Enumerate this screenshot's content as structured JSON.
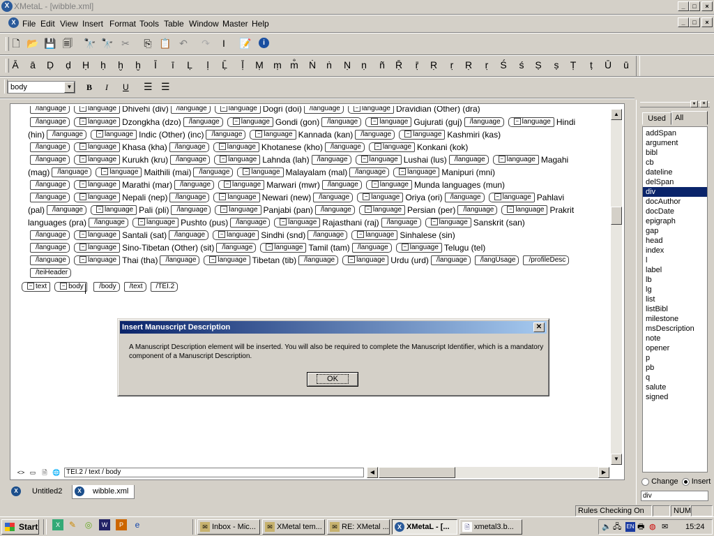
{
  "window": {
    "title": "XMetaL - [wibble.xml]",
    "controls": [
      "_",
      "□",
      "×"
    ]
  },
  "menu": [
    "File",
    "Edit",
    "View",
    "Insert",
    "Format",
    "Tools",
    "Table",
    "Window",
    "Master",
    "Help"
  ],
  "chars": [
    "Ā",
    "ā",
    "Ḍ",
    "ḍ",
    "Ḥ",
    "ḥ",
    "ḫ",
    "ḫ",
    "Ī",
    "ī",
    "Ḷ",
    "ḷ",
    "Ḹ",
    "ḹ",
    "Ṃ",
    "ṃ",
    "m̐",
    "Ṅ",
    "ṅ",
    "Ṇ",
    "ṇ",
    "ñ",
    "Ṝ",
    "ṝ",
    "Ṛ",
    "ṛ",
    "Ṛ",
    "ṛ",
    "Ś",
    "ś",
    "Ṣ",
    "ṣ",
    "Ṭ",
    "ṭ",
    "Ū",
    "ū"
  ],
  "format": {
    "style": "body",
    "bold": "B",
    "italic": "I",
    "underline": "U"
  },
  "editor": {
    "lines": [
      [
        [
          "c",
          "language"
        ],
        [
          "o",
          "language"
        ],
        [
          "t",
          "Dhivehi (div)"
        ],
        [
          "c",
          "language"
        ],
        [
          "o",
          "language"
        ],
        [
          "t",
          "Dogri (doi)"
        ],
        [
          "c",
          "language"
        ],
        [
          "o",
          "language"
        ],
        [
          "t",
          "Dravidian (Other) (dra)"
        ]
      ],
      [
        [
          "c",
          "language"
        ],
        [
          "o",
          "language"
        ],
        [
          "t",
          "Dzongkha (dzo)"
        ],
        [
          "c",
          "language"
        ],
        [
          "o",
          "language"
        ],
        [
          "t",
          "Gondi (gon)"
        ],
        [
          "c",
          "language"
        ],
        [
          "o",
          "language"
        ],
        [
          "t",
          "Gujurati (guj)"
        ],
        [
          "c",
          "language"
        ],
        [
          "o",
          "language"
        ],
        [
          "t",
          "Hindi"
        ]
      ],
      [
        [
          "t",
          "(hin)"
        ],
        [
          "c",
          "language"
        ],
        [
          "o",
          "language"
        ],
        [
          "t",
          "Indic (Other) (inc)"
        ],
        [
          "c",
          "language"
        ],
        [
          "o",
          "language"
        ],
        [
          "t",
          "Kannada (kan)"
        ],
        [
          "c",
          "language"
        ],
        [
          "o",
          "language"
        ],
        [
          "t",
          "Kashmiri (kas)"
        ]
      ],
      [
        [
          "c",
          "language"
        ],
        [
          "o",
          "language"
        ],
        [
          "t",
          "Khasa (kha)"
        ],
        [
          "c",
          "language"
        ],
        [
          "o",
          "language"
        ],
        [
          "t",
          "Khotanese (kho)"
        ],
        [
          "c",
          "language"
        ],
        [
          "o",
          "language"
        ],
        [
          "t",
          "Konkani (kok)"
        ]
      ],
      [
        [
          "c",
          "language"
        ],
        [
          "o",
          "language"
        ],
        [
          "t",
          "Kurukh (kru)"
        ],
        [
          "c",
          "language"
        ],
        [
          "o",
          "language"
        ],
        [
          "t",
          "Lahnda (lah)"
        ],
        [
          "c",
          "language"
        ],
        [
          "o",
          "language"
        ],
        [
          "t",
          "Lushai (lus)"
        ],
        [
          "c",
          "language"
        ],
        [
          "o",
          "language"
        ],
        [
          "t",
          "Magahi"
        ]
      ],
      [
        [
          "t",
          "(mag)"
        ],
        [
          "c",
          "language"
        ],
        [
          "o",
          "language"
        ],
        [
          "t",
          "Maithili (mai)"
        ],
        [
          "c",
          "language"
        ],
        [
          "o",
          "language"
        ],
        [
          "t",
          "Malayalam (mal)"
        ],
        [
          "c",
          "language"
        ],
        [
          "o",
          "language"
        ],
        [
          "t",
          "Manipuri (mni)"
        ]
      ],
      [
        [
          "c",
          "language"
        ],
        [
          "o",
          "language"
        ],
        [
          "t",
          "Marathi (mar)"
        ],
        [
          "c",
          "language"
        ],
        [
          "o",
          "language"
        ],
        [
          "t",
          "Marwari (mwr)"
        ],
        [
          "c",
          "language"
        ],
        [
          "o",
          "language"
        ],
        [
          "t",
          "Munda languages (mun)"
        ]
      ],
      [
        [
          "c",
          "language"
        ],
        [
          "o",
          "language"
        ],
        [
          "t",
          "Nepali (nep)"
        ],
        [
          "c",
          "language"
        ],
        [
          "o",
          "language"
        ],
        [
          "t",
          "Newari (new)"
        ],
        [
          "c",
          "language"
        ],
        [
          "o",
          "language"
        ],
        [
          "t",
          "Oriya (ori)"
        ],
        [
          "c",
          "language"
        ],
        [
          "o",
          "language"
        ],
        [
          "t",
          "Pahlavi"
        ]
      ],
      [
        [
          "t",
          "(pal)"
        ],
        [
          "c",
          "language"
        ],
        [
          "o",
          "language"
        ],
        [
          "t",
          "Pali (pli)"
        ],
        [
          "c",
          "language"
        ],
        [
          "o",
          "language"
        ],
        [
          "t",
          "Panjabi (pan)"
        ],
        [
          "c",
          "language"
        ],
        [
          "o",
          "language"
        ],
        [
          "t",
          "Persian (per)"
        ],
        [
          "c",
          "language"
        ],
        [
          "o",
          "language"
        ],
        [
          "t",
          "Prakrit"
        ]
      ],
      [
        [
          "t",
          "languages (pra)"
        ],
        [
          "c",
          "language"
        ],
        [
          "o",
          "language"
        ],
        [
          "t",
          "Pushto (pus)"
        ],
        [
          "c",
          "language"
        ],
        [
          "o",
          "language"
        ],
        [
          "t",
          "Rajasthani (raj)"
        ],
        [
          "c",
          "language"
        ],
        [
          "o",
          "language"
        ],
        [
          "t",
          "Sanskrit (san)"
        ]
      ],
      [
        [
          "c",
          "language"
        ],
        [
          "o",
          "language"
        ],
        [
          "t",
          "Santali (sat)"
        ],
        [
          "c",
          "language"
        ],
        [
          "o",
          "language"
        ],
        [
          "t",
          "Sindhi (snd)"
        ],
        [
          "c",
          "language"
        ],
        [
          "o",
          "language"
        ],
        [
          "t",
          "Sinhalese (sin)"
        ]
      ],
      [
        [
          "c",
          "language"
        ],
        [
          "o",
          "language"
        ],
        [
          "t",
          "Sino-Tibetan (Other) (sit)"
        ],
        [
          "c",
          "language"
        ],
        [
          "o",
          "language"
        ],
        [
          "t",
          "Tamil (tam)"
        ],
        [
          "c",
          "language"
        ],
        [
          "o",
          "language"
        ],
        [
          "t",
          "Telugu (tel)"
        ]
      ],
      [
        [
          "c",
          "language"
        ],
        [
          "o",
          "language"
        ],
        [
          "t",
          "Thai (tha)"
        ],
        [
          "c",
          "language"
        ],
        [
          "o",
          "language"
        ],
        [
          "t",
          "Tibetan (tib)"
        ],
        [
          "c",
          "language"
        ],
        [
          "o",
          "language"
        ],
        [
          "t",
          "Urdu (urd)"
        ],
        [
          "c",
          "language"
        ],
        [
          "c",
          "langUsage"
        ],
        [
          "c",
          "profileDesc"
        ]
      ],
      [
        [
          "c",
          "teiHeader"
        ]
      ],
      [
        [
          "o",
          "text"
        ],
        [
          "o",
          "body"
        ],
        [
          "t",
          " "
        ],
        [
          "c",
          "body"
        ],
        [
          "c",
          "text"
        ],
        [
          "c",
          "TEI.2"
        ]
      ]
    ],
    "path": "TEI.2 / text / body"
  },
  "tabs": [
    "Untitled2",
    "wibble.xml"
  ],
  "panel": {
    "tab_used": "Used",
    "tab_all": "All",
    "elements": [
      "addSpan",
      "argument",
      "bibl",
      "cb",
      "dateline",
      "delSpan",
      "div",
      "docAuthor",
      "docDate",
      "epigraph",
      "gap",
      "head",
      "index",
      "l",
      "label",
      "lb",
      "lg",
      "list",
      "listBibl",
      "milestone",
      "msDescription",
      "note",
      "opener",
      "p",
      "pb",
      "q",
      "salute",
      "signed"
    ],
    "selected": "div",
    "radio_change": "Change",
    "radio_insert": "Insert",
    "field": "div"
  },
  "dialog": {
    "title": "Insert Manuscript Description",
    "message": "A Manuscript Description element will be inserted. You will also be required to complete the Manuscript Identifier, which is a mandatory component of a Manuscript Description.",
    "ok": "OK"
  },
  "status": {
    "rules": "Rules Checking On",
    "num": "NUM"
  },
  "taskbar": {
    "start": "Start",
    "tasks": [
      "Inbox - Mic...",
      "XMetal tem...",
      "RE: XMetal ...",
      "XMetaL - [...",
      "xmetal3.b..."
    ],
    "active": 3,
    "tray_lang": "EN",
    "clock": "15:24"
  }
}
